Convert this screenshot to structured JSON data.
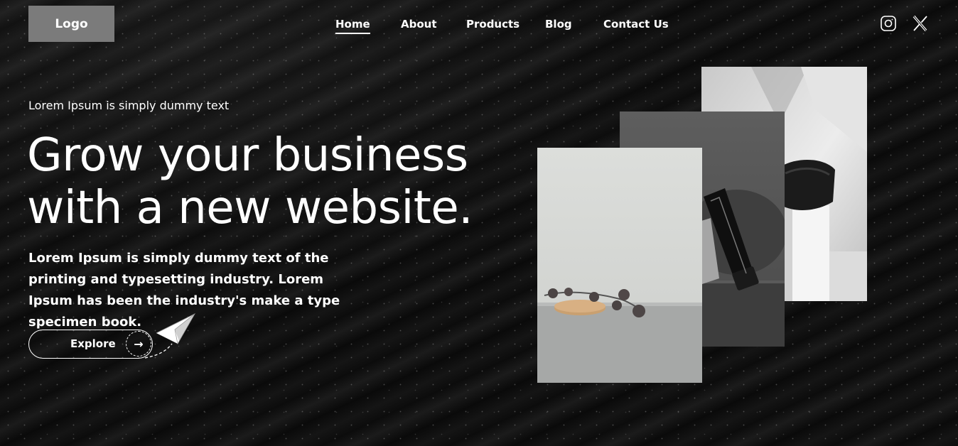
{
  "header": {
    "logo": "Logo",
    "nav": [
      {
        "label": "Home",
        "active": true
      },
      {
        "label": "About",
        "active": false
      },
      {
        "label": "Products",
        "active": false
      },
      {
        "label": "Blog",
        "active": false
      },
      {
        "label": "Contact Us",
        "active": false
      }
    ],
    "social_icons": [
      "instagram-icon",
      "x-icon"
    ]
  },
  "hero": {
    "tagline": "Lorem Ipsum is simply dummy text",
    "headline_line1": "Grow your business",
    "headline_line2": "with a new website.",
    "description": "Lorem Ipsum is simply dummy text of the printing and typesetting industry. Lorem Ipsum has been the industry's make a type specimen book.",
    "cta_label": "Explore",
    "cta_icon": "arrow-right-icon",
    "decor_icon": "paper-plane-icon"
  },
  "gallery": {
    "images": [
      {
        "name": "white-block-still-life"
      },
      {
        "name": "black-tube-product"
      },
      {
        "name": "wooden-dish-berries"
      }
    ]
  },
  "colors": {
    "background": "#0d0d0d",
    "logo_bg": "#7b7b7b",
    "text": "#ffffff"
  }
}
